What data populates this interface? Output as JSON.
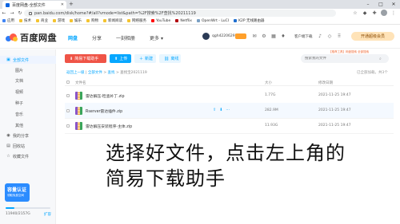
{
  "browser": {
    "tab_title": "百度网盘-全部文件",
    "url": "pan.baidu.com/disk/home?#/all?vmode=list&path=%2F搜索%2F查找%20211119",
    "bookmarks": [
      "应用",
      "技术",
      "商业",
      "游戏",
      "娱乐",
      "购物",
      "新闻阅读",
      "网络服务",
      "YouTube",
      "Netflix",
      "OpenWrt - LuCI",
      "K2P 无线路由器"
    ]
  },
  "app": {
    "logo_text": "百度网盘",
    "nav": [
      "网盘",
      "分享",
      "一刻相册",
      "更多"
    ],
    "username": "qgh422062953",
    "client_download": "客户端下载",
    "vip_button": "开通超级会员"
  },
  "sidebar": {
    "items": [
      {
        "label": "全部文件",
        "icon": "folder-icon"
      },
      {
        "label": "图片"
      },
      {
        "label": "文档"
      },
      {
        "label": "视频"
      },
      {
        "label": "种子"
      },
      {
        "label": "音乐"
      },
      {
        "label": "其他"
      },
      {
        "label": "我的分享",
        "icon": "share-icon"
      },
      {
        "label": "回收站",
        "icon": "trash-icon"
      },
      {
        "label": "收藏文件",
        "icon": "star-icon"
      }
    ],
    "quota_card_title": "容量认证",
    "quota_card_sub": "领取免费空间",
    "quota_text": "11940/2157G",
    "quota_fraction": 0.2,
    "expand": "扩容"
  },
  "main": {
    "buttons": {
      "download_helper": "简易下载助手",
      "upload": "上传",
      "new_folder": "新建",
      "offline": "离线"
    },
    "search_placeholder": "搜索我的文件",
    "search_tip": "【推荐工具】网盘搜索 全部搜索",
    "breadcrumb": {
      "back": "返回上一级",
      "all": "全部文件",
      "folder1": "查找",
      "current": "查找宝2021119"
    },
    "loaded": "已全部加载，共3个",
    "columns": {
      "name": "文件名",
      "size": "大小",
      "time": "修改日期"
    },
    "files": [
      {
        "name": "雷达解压-检查补丁.zip",
        "size": "1.77G",
        "time": "2021-11-25 19:47"
      },
      {
        "name": "Rserver雷达插件.zip",
        "size": "282.9M",
        "time": "2021-11-25 19:47"
      },
      {
        "name": "雷达解压安装程序-主体.zip",
        "size": "11.93G",
        "time": "2021-11-25 19:47"
      }
    ]
  },
  "caption": {
    "line1": "选择好文件，点击左上角的",
    "line2": "简易下载助手"
  }
}
